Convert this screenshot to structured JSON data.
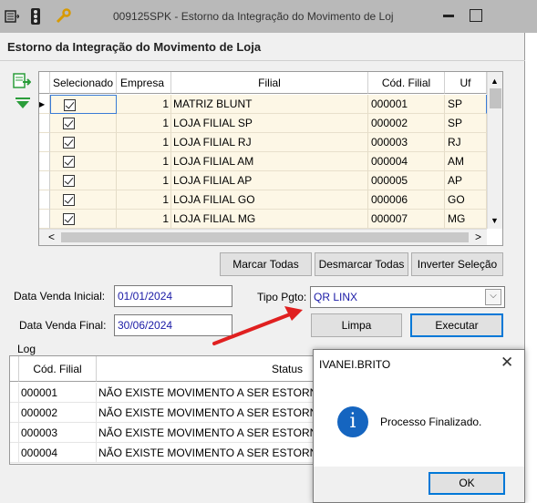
{
  "window": {
    "title": "009125SPK - Estorno da Integração do Movimento de Loj",
    "heading": "Estorno da Integração do Movimento de Loja",
    "controls": {
      "minimize": "minimize-icon",
      "maximize": "maximize-icon"
    }
  },
  "grid": {
    "columns": [
      "Selecionado",
      "Empresa",
      "Filial",
      "Cód. Filial",
      "Uf"
    ],
    "rows": [
      {
        "empresa": "1",
        "filial": "MATRIZ BLUNT",
        "cod": "000001",
        "uf": "SP"
      },
      {
        "empresa": "1",
        "filial": "LOJA FILIAL SP",
        "cod": "000002",
        "uf": "SP"
      },
      {
        "empresa": "1",
        "filial": "LOJA FILIAL RJ",
        "cod": "000003",
        "uf": "RJ"
      },
      {
        "empresa": "1",
        "filial": "LOJA FILIAL AM",
        "cod": "000004",
        "uf": "AM"
      },
      {
        "empresa": "1",
        "filial": "LOJA FILIAL AP",
        "cod": "000005",
        "uf": "AP"
      },
      {
        "empresa": "1",
        "filial": "LOJA FILIAL GO",
        "cod": "000006",
        "uf": "GO"
      },
      {
        "empresa": "1",
        "filial": "LOJA FILIAL MG",
        "cod": "000007",
        "uf": "MG"
      }
    ]
  },
  "buttons": {
    "marcar": "Marcar Todas",
    "desmarcar": "Desmarcar Todas",
    "inverter": "Inverter Seleção",
    "limpa": "Limpa",
    "executar": "Executar"
  },
  "form": {
    "data_inicial_label": "Data Venda Inicial:",
    "data_inicial": "01/01/2024",
    "data_final_label": "Data Venda Final:",
    "data_final": "30/06/2024",
    "tipo_pgto_label": "Tipo Pgto:",
    "tipo_pgto": "QR LINX"
  },
  "log": {
    "label": "Log",
    "columns": [
      "Cód. Filial",
      "Status"
    ],
    "rows": [
      {
        "cod": "000001",
        "status": "NÃO EXISTE MOVIMENTO A SER ESTORNA"
      },
      {
        "cod": "000002",
        "status": "NÃO EXISTE MOVIMENTO A SER ESTORNA"
      },
      {
        "cod": "000003",
        "status": "NÃO EXISTE MOVIMENTO A SER ESTORNA"
      },
      {
        "cod": "000004",
        "status": "NÃO EXISTE MOVIMENTO A SER ESTORNA"
      }
    ]
  },
  "dialog": {
    "title": "IVANEI.BRITO",
    "close": "✕",
    "message": "Processo Finalizado.",
    "icon_glyph": "i",
    "ok": "OK"
  },
  "colors": {
    "accent": "#e02020",
    "info": "#1565c0",
    "selected_row": "#fdf7e6"
  }
}
